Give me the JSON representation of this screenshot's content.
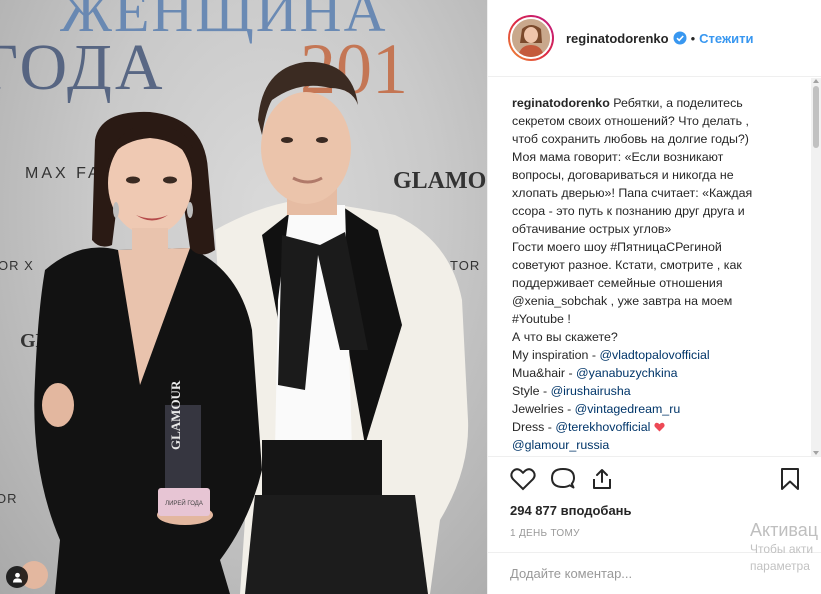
{
  "backdrop": {
    "top_text": "ЖЕНЩИНА",
    "goda_text": "ГОДА",
    "year_text": "201",
    "brand_maxfactor": "MAX FA",
    "brand_glamour": "GLAMOUR",
    "brand_glamour_small": "GLA",
    "brand_torx": "OR X",
    "brand_torx_right": "TOR",
    "brand_tor_bottom": "OR"
  },
  "award": {
    "brand": "GLAMOUR",
    "plate": "ЛИРЕЙ ГОДА"
  },
  "header": {
    "username": "reginatodorenko",
    "separator": "•",
    "follow_label": "Стежити"
  },
  "caption": {
    "author": "reginatodorenko",
    "lines": [
      "Ребятки, а поделитесь",
      "секретом своих отношений? Что делать ,",
      "чтоб сохранить любовь на долгие годы?)",
      "Моя мама говорит: «Если возникают",
      "вопросы, договариваться и никогда не",
      "хлопать дверью»! Папа считает: «Каждая",
      "ссора - это путь к познанию друг друга и",
      "обтачивание острых углов»",
      "Гости моего шоу #ПятницаСРегиной",
      "советуют разное. Кстати, смотрите , как",
      "поддерживает семейные отношения",
      "@xenia_sobchak , уже завтра на моем",
      "#Youtube !",
      "А что вы скажете?"
    ],
    "credits": [
      {
        "label": "My inspiration - ",
        "mention": "@vladtopalovofficial"
      },
      {
        "label": "Mua&hair - ",
        "mention": "@yanabuzychkina"
      },
      {
        "label": "Style - ",
        "mention": "@irushairusha"
      },
      {
        "label": "Jewelries - ",
        "mention": "@vintagedream_ru"
      },
      {
        "label": "Dress - ",
        "mention": "@terekhovofficial"
      }
    ],
    "last_mention": "@glamour_russia"
  },
  "stats": {
    "likes": "294 877 вподобань",
    "time": "1 день тому"
  },
  "comment": {
    "placeholder": "Додайте коментар..."
  },
  "watermark": {
    "title": "Активац",
    "line1": "Чтобы акти",
    "line2": "параметра"
  },
  "colors": {
    "accent": "#3897f0",
    "heart": "#ed4956",
    "verified": "#3897f0"
  }
}
